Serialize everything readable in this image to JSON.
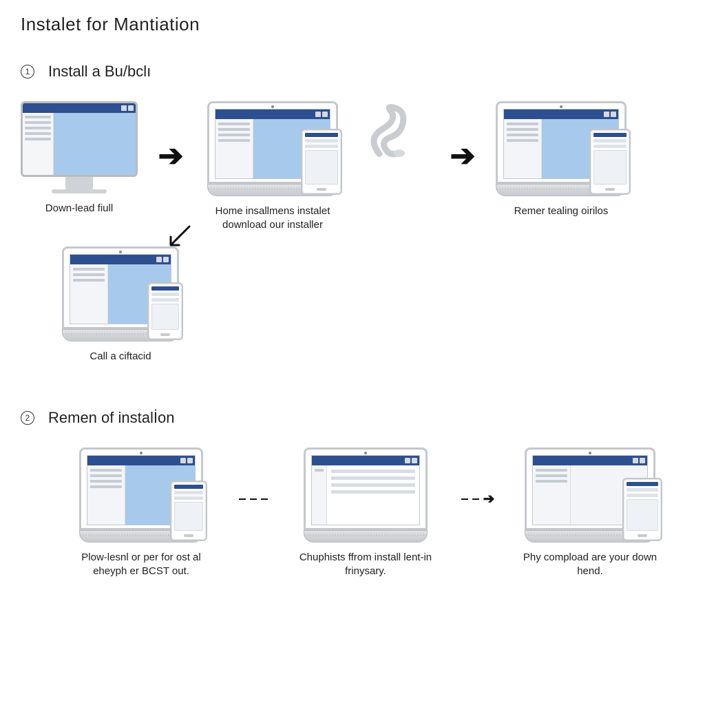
{
  "title": "Instalet for Mantiation",
  "section1": {
    "number": "1",
    "heading": "Install a Bu/bclı",
    "steps": {
      "s1": {
        "caption": "Down-lead fiull"
      },
      "s2": {
        "caption": "Home insallmens instalet download our installer"
      },
      "s3": {
        "caption": "Remer tealing oirilos"
      },
      "s4": {
        "caption": "Call a ciftacid"
      }
    }
  },
  "section2": {
    "number": "2",
    "heading": "Remen of instalİon",
    "steps": {
      "s1": {
        "caption": "Plow-lesnl or per for ost al eheyph er BCST out."
      },
      "s2": {
        "caption": "Chuphists ffrom install lent-in frinysary."
      },
      "s3": {
        "caption": "Phy compload are your down hend."
      }
    }
  }
}
